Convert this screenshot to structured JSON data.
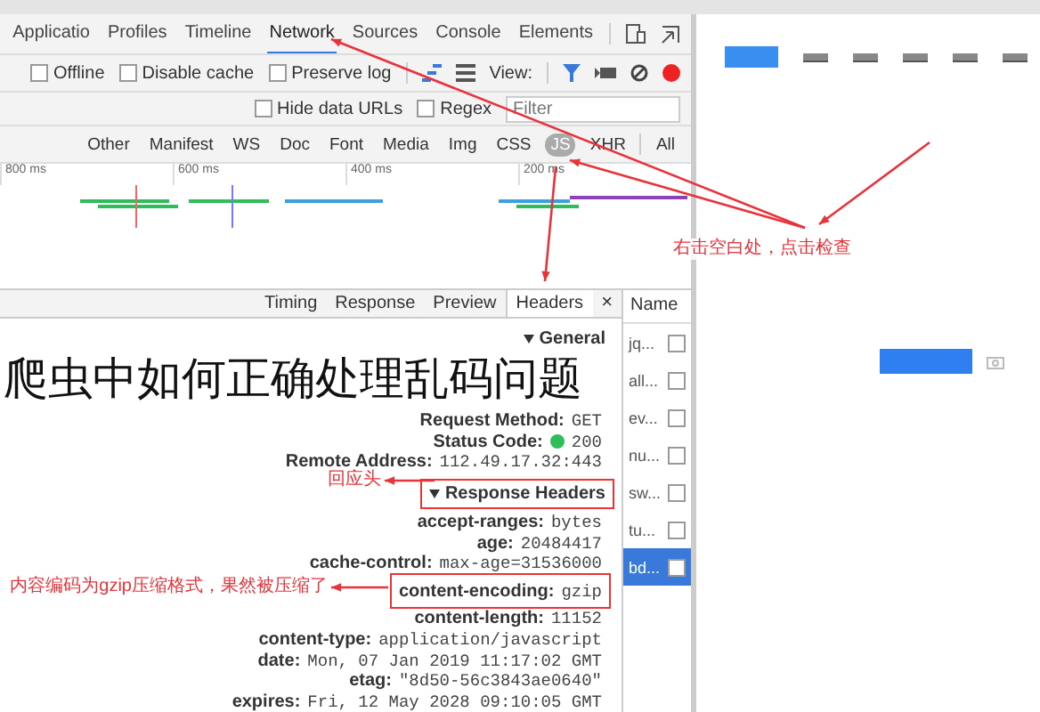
{
  "devtools": {
    "panel_tabs": [
      {
        "label": "Applicatio",
        "selected": false
      },
      {
        "label": "Profiles",
        "selected": false
      },
      {
        "label": "Timeline",
        "selected": false
      },
      {
        "label": "Network",
        "selected": true
      },
      {
        "label": "Sources",
        "selected": false
      },
      {
        "label": "Console",
        "selected": false
      },
      {
        "label": "Elements",
        "selected": false
      }
    ],
    "toolbar": {
      "view_label": "View:",
      "checkboxes": [
        {
          "label": "Offline",
          "checked": false
        },
        {
          "label": "Disable cache",
          "checked": false
        },
        {
          "label": "Preserve log",
          "checked": false
        }
      ]
    },
    "filter": {
      "placeholder": "Filter",
      "checkboxes": [
        {
          "label": "Hide data URLs",
          "checked": false
        },
        {
          "label": "Regex",
          "checked": false
        }
      ]
    },
    "type_filters": [
      {
        "label": "Other",
        "selected": false
      },
      {
        "label": "Manifest",
        "selected": false
      },
      {
        "label": "WS",
        "selected": false
      },
      {
        "label": "Doc",
        "selected": false
      },
      {
        "label": "Font",
        "selected": false
      },
      {
        "label": "Media",
        "selected": false
      },
      {
        "label": "Img",
        "selected": false
      },
      {
        "label": "CSS",
        "selected": false
      },
      {
        "label": "JS",
        "selected": true
      },
      {
        "label": "XHR",
        "selected": false
      },
      {
        "label": "All",
        "selected": false
      }
    ],
    "timeline": {
      "ticks": [
        "800 ms",
        "600 ms",
        "400 ms",
        "200 ms"
      ]
    },
    "requests": {
      "header": "Name",
      "items": [
        {
          "name": "jq...",
          "selected": false
        },
        {
          "name": "all...",
          "selected": false
        },
        {
          "name": "ev...",
          "selected": false
        },
        {
          "name": "nu...",
          "selected": false
        },
        {
          "name": "sw...",
          "selected": false
        },
        {
          "name": "tu...",
          "selected": false
        },
        {
          "name": "bd...",
          "selected": true
        }
      ]
    },
    "details": {
      "close": "×",
      "tabs": [
        {
          "label": "Timing",
          "selected": false
        },
        {
          "label": "Response",
          "selected": false
        },
        {
          "label": "Preview",
          "selected": false
        },
        {
          "label": "Headers",
          "selected": true
        }
      ],
      "sections": [
        {
          "title": "General",
          "expanded": true,
          "boxed": false,
          "rows": [
            {
              "key": "Request Method:",
              "value": "GET",
              "kind": "text",
              "boxed": false
            },
            {
              "key": "Status Code:",
              "value": "200",
              "kind": "status",
              "boxed": false
            },
            {
              "key": "Remote Address:",
              "value": "112.49.17.32:443",
              "kind": "text",
              "boxed": false
            }
          ]
        },
        {
          "title": "Response Headers",
          "expanded": true,
          "boxed": true,
          "rows": [
            {
              "key": "accept-ranges:",
              "value": "bytes",
              "kind": "text",
              "boxed": false
            },
            {
              "key": "age:",
              "value": "20484417",
              "kind": "text",
              "boxed": false
            },
            {
              "key": "cache-control:",
              "value": "max-age=31536000",
              "kind": "text",
              "boxed": false
            },
            {
              "key": "content-encoding:",
              "value": "gzip",
              "kind": "text",
              "boxed": true
            },
            {
              "key": "content-length:",
              "value": "11152",
              "kind": "text",
              "boxed": false
            },
            {
              "key": "content-type:",
              "value": "application/javascript",
              "kind": "text",
              "boxed": false
            },
            {
              "key": "date:",
              "value": "Mon, 07 Jan 2019 11:17:02 GMT",
              "kind": "text",
              "boxed": false
            },
            {
              "key": "etag:",
              "value": "\"8d50-56c3843ae0640\"",
              "kind": "text",
              "boxed": false
            },
            {
              "key": "expires:",
              "value": "Fri, 12 May 2028 09:10:05 GMT",
              "kind": "text",
              "boxed": false
            }
          ]
        }
      ]
    }
  },
  "annotations": [
    "右击空白处，点击检查",
    "回应头",
    "内容编码为gzip压缩格式，果然被压缩了"
  ],
  "title": "爬虫中如何正确处理乱码问题"
}
